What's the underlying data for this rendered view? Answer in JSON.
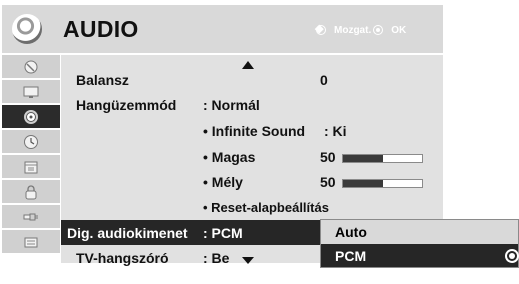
{
  "header": {
    "title": "AUDIO",
    "hint_move": "Mozgat.",
    "hint_ok": "OK",
    "icon": "speaker-icon"
  },
  "sidebar": {
    "items": [
      {
        "icon": "satellite-dish-icon"
      },
      {
        "icon": "picture-tv-icon"
      },
      {
        "icon": "audio-speaker-icon",
        "active": true
      },
      {
        "icon": "clock-icon"
      },
      {
        "icon": "calendar-options-icon"
      },
      {
        "icon": "lock-icon"
      },
      {
        "icon": "input-plug-icon"
      },
      {
        "icon": "usb-media-icon"
      }
    ]
  },
  "settings": {
    "balance": {
      "label": "Balansz",
      "value": "0"
    },
    "sound_mode": {
      "label": "Hangüzemmód",
      "value": ": Normál"
    },
    "infinite_sound": {
      "label": "• Infinite Sound",
      "value": ": Ki"
    },
    "treble": {
      "label": "• Magas",
      "value": "50",
      "level": 0.5
    },
    "bass": {
      "label": "• Mély",
      "value": "50",
      "level": 0.5
    },
    "reset": {
      "label": "• Reset-alapbeállítás"
    },
    "digital_audio_out": {
      "label": "Dig. audiokimenet",
      "value": ": PCM"
    },
    "tv_speaker": {
      "label": "TV-hangszóró",
      "value": ": Be"
    }
  },
  "popup": {
    "options": [
      "Auto",
      "PCM"
    ],
    "selected": "PCM"
  },
  "colors": {
    "highlight": "#262626",
    "panel": "#e1e1e1",
    "header": "#d9d9d9"
  }
}
